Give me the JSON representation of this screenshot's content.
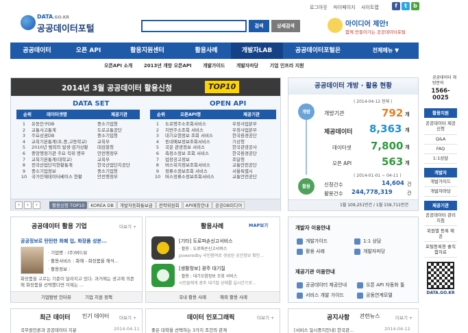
{
  "header": {
    "logo_top": "DATA",
    "logo_domain": ".GO.KR",
    "logo_name": "공공데이터포털",
    "search_button": "검색",
    "detail_search": "상세검색",
    "util": [
      "로그아웃",
      "마이페이지",
      "사이트맵"
    ],
    "social": [
      "f",
      "t",
      "b"
    ],
    "banner_line1": "아이디어 제안!",
    "banner_line2": "함께 만들어가는 공공데이터포털"
  },
  "nav": {
    "items": [
      "공공데이터",
      "오픈 API",
      "활용지원센터",
      "활용사례",
      "개발자LAB",
      "공공데이터포털은"
    ],
    "all_menu": "전체메뉴 ▼"
  },
  "subnav": [
    "오픈API 소개",
    "2013년 개방 오픈API",
    "개발가이드",
    "개발자마당",
    "기업 인프라 지원"
  ],
  "top10": {
    "title": "2014년 3월 공공데이터 활용신청",
    "badge": "TOP10",
    "dataset_title": "DATA SET",
    "openapi_title": "OPEN API",
    "col_rank": "순위",
    "col_dataset": "데이터셋명",
    "col_org": "제공기관",
    "col_api": "오픈API명",
    "datasets": [
      [
        "1",
        "유동인구DB",
        "중소기업청"
      ],
      [
        "2",
        "교통사고통계",
        "도로교통공단"
      ],
      [
        "3",
        "주요상권DB",
        "중소기업청"
      ],
      [
        "4",
        "교육기본통계(초,중,고등학교)",
        "교육부"
      ],
      [
        "5",
        "2010년 범죄의 발생·검거상황",
        "대검찰청"
      ],
      [
        "6",
        "중앙행정기관 주요 직위 명부",
        "안전행정부"
      ],
      [
        "7",
        "교육기본통계(대학교)",
        "교육부"
      ],
      [
        "8",
        "전국산업단지현황통계",
        "한국산업단지공단"
      ],
      [
        "9",
        "중소기업정보",
        "중소기업청"
      ],
      [
        "10",
        "국가인재데이터베이스 현황",
        "안전행정부"
      ]
    ],
    "apis": [
      [
        "1",
        "도로명주소조회서비스",
        "우정사업본부"
      ],
      [
        "2",
        "지번주소조회 서비스",
        "우정사업본부"
      ],
      [
        "3",
        "대기오염정보 조회 서비스",
        "한국환경공단"
      ],
      [
        "4",
        "동네예보정보조회서비스",
        "기상청"
      ],
      [
        "5",
        "국문 관광정보 서비스",
        "한국관광공사"
      ],
      [
        "6",
        "측정소정보 조회 서비스",
        "한국환경공단"
      ],
      [
        "7",
        "업장공고정보",
        "조달청"
      ],
      [
        "8",
        "버스위치정보조회서비스",
        "교통안전공단"
      ],
      [
        "9",
        "정류소정보조회 서비스",
        "서울특별시"
      ],
      [
        "10",
        "버스정류소정보조회서비스",
        "교통안전공단"
      ]
    ],
    "tabs": [
      "활용신청 TOP10",
      "KOREA DB",
      "개발자동화통보금",
      "전략위원회",
      "API매칭안내",
      "공공DB미디어"
    ]
  },
  "stats": {
    "title": "공공데이터 개방 · 활용 현황",
    "date1": "( 2014-04-12 현재 )",
    "open_label": "개방",
    "org_label": "개방기관",
    "org_val": "792",
    "unit": "개",
    "data_label": "제공데이터",
    "data_val": "8,363",
    "dataset_label": "데이터셋",
    "dataset_val": "7,800",
    "api_label": "오픈 API",
    "api_val": "563",
    "date2": "( 2014-01-01 ~ 04-11 )",
    "use_label": "활용",
    "apply_label": "신청건수",
    "apply_val": "14,604",
    "apply_unit": "건",
    "use_count_label": "활용건수",
    "use_count_val": "244,778,319",
    "footer": "1월 109,251만건 / 1월 159,711만건"
  },
  "sidebar": {
    "phone_label": "공공데이터 개방문의",
    "phone": "1566-0025",
    "group1": "활용지원",
    "g1_items": [
      "공공데이터 제공신청",
      "Q&A",
      "FAQ",
      "1:1상담"
    ],
    "group2": "개발자",
    "g2_items": [
      "개발가이드",
      "개발자마당"
    ],
    "group3": "제공기관",
    "g3_items": [
      "공공데이터 관리지침",
      "위원별 등록 제공",
      "포털등록용 솔직함자료"
    ],
    "qr_label": "DATA.GO.KR"
  },
  "company": {
    "title": "공공데이터 활용 기업",
    "more": "더보기 +",
    "headline": "공공정보로 탄탄한 화폐 업, 화장품 성분...",
    "meta": [
      "· 기업명 : (주)버드뷰",
      "· 활용서비스 : 화해 - 화장품을 해석...",
      "· 활용정보 :"
    ],
    "desc": "화장품을 고르는 기준이 달라지고 있다. 과거에는 광고에 의존해 화장품을 선택했다면 이제는 ...",
    "links": [
      "기업탐방 인터뷰",
      "기업 지원 정책"
    ]
  },
  "cases": {
    "title": "활용사례",
    "map_badge": "MAP보기",
    "items": [
      {
        "name": "[기타] 도로파손신고서비스",
        "sub": "· 활용 : 도로파손신고서비스",
        "desc": "poweredby 국민참여로 생성된 공간정보 확인..."
      },
      {
        "name": "[생활정보] 광주 대기질",
        "sub": "· 활용 : 대기오염정보 조회 서비스",
        "desc": "시민들에게 광주 대기질 상태를 실시간으로..."
      }
    ],
    "links": [
      "국내 활용 사례",
      "해외 활용 사례"
    ]
  },
  "devguide": {
    "title": "개발자 이용안내",
    "items": [
      "개발가이드",
      "1:1 상담",
      "활용 사례",
      "개발자마당"
    ],
    "title2": "제공기관 이용안내",
    "items2": [
      "공공데이터 제공안내",
      "오픈 API 자동화 툴",
      "서비스 개발 가이드",
      "공동연계모델"
    ]
  },
  "bottom": {
    "recent": "최근 데이터",
    "popular": "인기 데이터",
    "recent_more": "더보기 +",
    "recent_item": "국무원인론과 공공데이터 지분",
    "recent_date": "2014-04-11",
    "info": "데이터 인포그래픽",
    "info_more": "더보기 +",
    "info_item": "좋은 대학을 선택하는 3가지 조건의 관계",
    "notice": "공지사항",
    "related": "관련뉴스",
    "notice_more": "더보기 +",
    "notice_item": "[서비스 일시중지안내] 한국관...",
    "notice_date": "2014-04-12"
  }
}
